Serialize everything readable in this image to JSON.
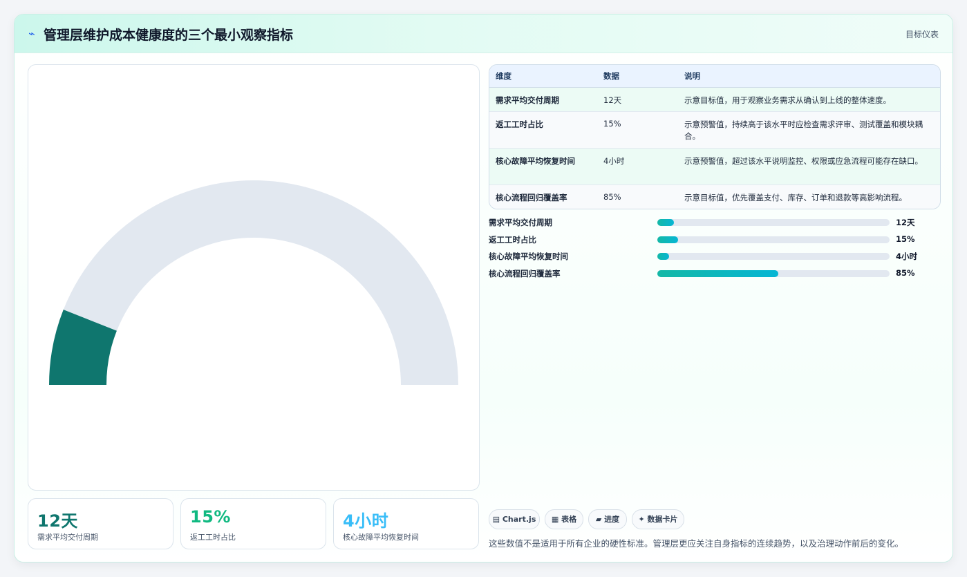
{
  "header": {
    "title": "管理层维护成本健康度的三个最小观察指标",
    "icon": "lightning-icon",
    "tag": "目标仪表"
  },
  "chart_data": [
    {
      "type": "gauge",
      "title": "",
      "value": 12,
      "max": 100,
      "colors": {
        "value": "#0f766e",
        "track": "#e2e8f0"
      }
    },
    {
      "type": "bar",
      "orientation": "horizontal",
      "categories": [
        "需求平均交付周期",
        "返工工时占比",
        "核心故障平均恢复时间",
        "核心流程回归覆盖率"
      ],
      "values": [
        7,
        9,
        5,
        52
      ],
      "value_labels": [
        "12天",
        "15%",
        "4小时",
        "85%"
      ],
      "xlim": [
        0,
        100
      ]
    }
  ],
  "stats": [
    {
      "value": "12天",
      "label": "需求平均交付周期",
      "color": "#0f766e"
    },
    {
      "value": "15%",
      "label": "返工工时占比",
      "color": "#10b981"
    },
    {
      "value": "4小时",
      "label": "核心故障平均恢复时间",
      "color": "#38bdf8"
    }
  ],
  "table": {
    "headers": [
      "维度",
      "数据",
      "说明"
    ],
    "rows": [
      {
        "dim": "需求平均交付周期",
        "data": "12天",
        "desc": "示意目标值，用于观察业务需求从确认到上线的整体速度。"
      },
      {
        "dim": "返工工时占比",
        "data": "15%",
        "desc": "示意预警值，持续高于该水平时应检查需求评审、测试覆盖和模块耦合。"
      },
      {
        "dim": "核心故障平均恢复时间",
        "data": "4小时",
        "desc": "示意预警值，超过该水平说明监控、权限或应急流程可能存在缺口。"
      },
      {
        "dim": "核心流程回归覆盖率",
        "data": "85%",
        "desc": "示意目标值，优先覆盖支付、库存、订单和退款等高影响流程。"
      }
    ]
  },
  "chips": [
    {
      "icon": "chart-icon",
      "label": "Chart.js"
    },
    {
      "icon": "table-icon",
      "label": "表格"
    },
    {
      "icon": "progress-icon",
      "label": "进度"
    },
    {
      "icon": "card-icon",
      "label": "数据卡片"
    }
  ],
  "note": "这些数值不是适用于所有企业的硬性标准。管理层更应关注自身指标的连续趋势，以及治理动作前后的变化。"
}
